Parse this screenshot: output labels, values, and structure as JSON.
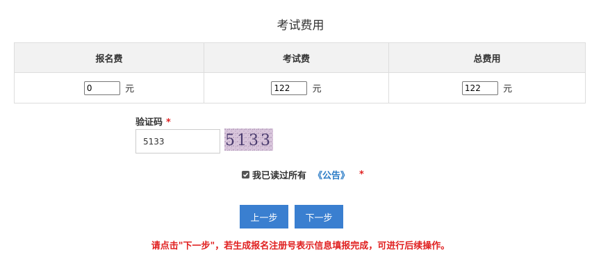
{
  "title": "考试费用",
  "fee_table": {
    "headers": [
      "报名费",
      "考试费",
      "总费用"
    ],
    "values": [
      "0",
      "122",
      "122"
    ],
    "unit": "元"
  },
  "captcha": {
    "label": "验证码",
    "required_mark": "*",
    "value": "5133",
    "image_text": "5133"
  },
  "agreement": {
    "checked": true,
    "text": "我已读过所有",
    "link": "《公告》",
    "required_mark": "*"
  },
  "buttons": {
    "prev": "上一步",
    "next": "下一步"
  },
  "hint": "请点击\"下一步\"，若生成报名注册号表示信息填报完成，可进行后续操作。",
  "colors": {
    "primary_button": "#3a7fd0",
    "hint_red": "#e02020",
    "link_blue": "#2a7bc6",
    "header_bg": "#f2f2f2"
  }
}
